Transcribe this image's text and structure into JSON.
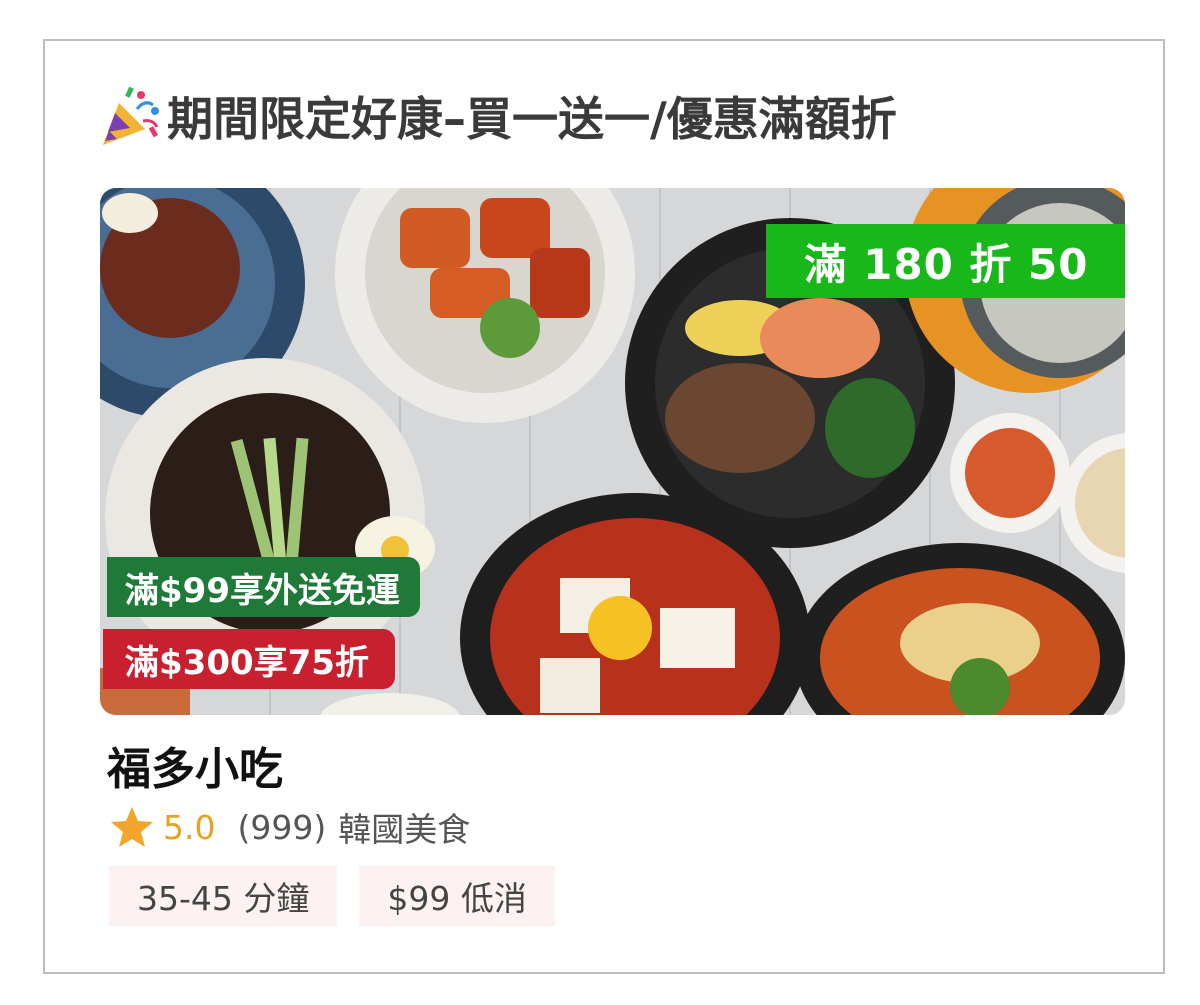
{
  "promo": {
    "icon": "party-popper-icon",
    "title": "期間限定好康–買一送一/優惠滿額折"
  },
  "banner": {
    "badge_top": "滿 180 折 50",
    "badge_ship": "滿$99享外送免運",
    "badge_discount": "滿$300享75折"
  },
  "store": {
    "name": "福多小吃",
    "rating_icon": "star-icon",
    "rating": "5.0",
    "review_count": "(999)",
    "cuisine": "韓國美食"
  },
  "tags": [
    {
      "label": "35-45 分鐘"
    },
    {
      "label": "$99 低消"
    }
  ],
  "colors": {
    "promo_green": "#19b81a",
    "ship_green": "#1f7a3a",
    "discount_red": "#c9202f",
    "rating_gold": "#e9a21f",
    "tag_bg": "#fdf1f1"
  }
}
